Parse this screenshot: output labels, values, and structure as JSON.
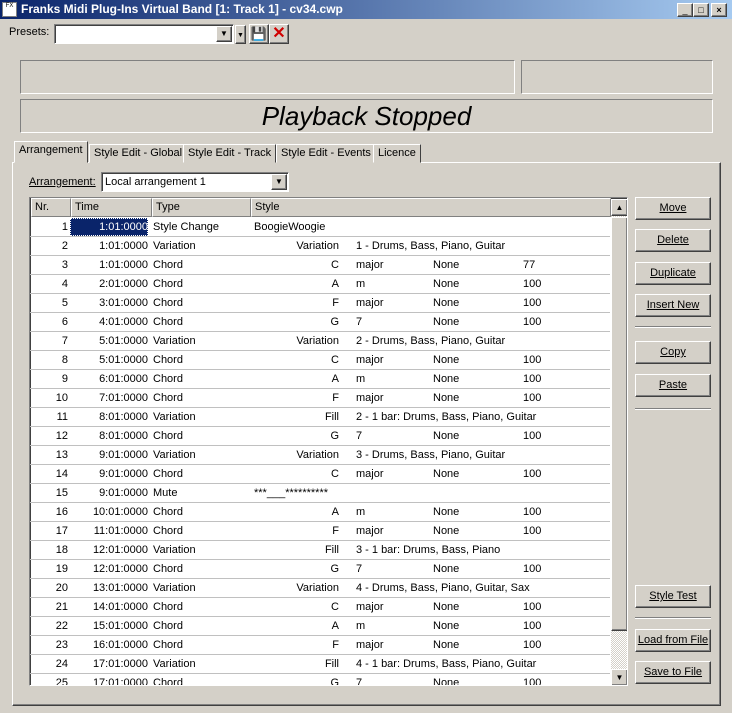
{
  "window": {
    "title": "Franks Midi Plug-Ins Virtual Band [1: Track 1] - cv34.cwp",
    "icon_text": "FX"
  },
  "presets": {
    "label": "Presets:",
    "value": ""
  },
  "status": {
    "playback": "Playback Stopped"
  },
  "tabs": [
    {
      "label": "Arrangement",
      "active": true
    },
    {
      "label": "Style Edit - Global"
    },
    {
      "label": "Style Edit - Track"
    },
    {
      "label": "Style Edit - Events"
    },
    {
      "label": "Licence"
    }
  ],
  "arrangement": {
    "label": "Arrangement:",
    "value": "Local arrangement 1"
  },
  "table": {
    "columns": [
      "Nr.",
      "Time",
      "Type",
      "Style"
    ],
    "rows": [
      {
        "nr": "1",
        "time": "1:01:0000",
        "type": "Style Change",
        "style": "BoogieWoogie"
      },
      {
        "nr": "2",
        "time": "1:01:0000",
        "type": "Variation",
        "main": "Variation",
        "sub": "1 - Drums, Bass, Piano, Guitar"
      },
      {
        "nr": "3",
        "time": "1:01:0000",
        "type": "Chord",
        "main": "C",
        "sub": "major",
        "none": "None",
        "val": "77"
      },
      {
        "nr": "4",
        "time": "2:01:0000",
        "type": "Chord",
        "main": "A",
        "sub": "m",
        "none": "None",
        "val": "100"
      },
      {
        "nr": "5",
        "time": "3:01:0000",
        "type": "Chord",
        "main": "F",
        "sub": "major",
        "none": "None",
        "val": "100"
      },
      {
        "nr": "6",
        "time": "4:01:0000",
        "type": "Chord",
        "main": "G",
        "sub": "7",
        "none": "None",
        "val": "100"
      },
      {
        "nr": "7",
        "time": "5:01:0000",
        "type": "Variation",
        "main": "Variation",
        "sub": "2 - Drums, Bass, Piano, Guitar"
      },
      {
        "nr": "8",
        "time": "5:01:0000",
        "type": "Chord",
        "main": "C",
        "sub": "major",
        "none": "None",
        "val": "100"
      },
      {
        "nr": "9",
        "time": "6:01:0000",
        "type": "Chord",
        "main": "A",
        "sub": "m",
        "none": "None",
        "val": "100"
      },
      {
        "nr": "10",
        "time": "7:01:0000",
        "type": "Chord",
        "main": "F",
        "sub": "major",
        "none": "None",
        "val": "100"
      },
      {
        "nr": "11",
        "time": "8:01:0000",
        "type": "Variation",
        "main": "Fill",
        "sub": "2 - 1 bar: Drums, Bass, Piano, Guitar"
      },
      {
        "nr": "12",
        "time": "8:01:0000",
        "type": "Chord",
        "main": "G",
        "sub": "7",
        "none": "None",
        "val": "100"
      },
      {
        "nr": "13",
        "time": "9:01:0000",
        "type": "Variation",
        "main": "Variation",
        "sub": "3 - Drums, Bass, Piano, Guitar"
      },
      {
        "nr": "14",
        "time": "9:01:0000",
        "type": "Chord",
        "main": "C",
        "sub": "major",
        "none": "None",
        "val": "100"
      },
      {
        "nr": "15",
        "time": "9:01:0000",
        "type": "Mute",
        "style": "***___**********"
      },
      {
        "nr": "16",
        "time": "10:01:0000",
        "type": "Chord",
        "main": "A",
        "sub": "m",
        "none": "None",
        "val": "100"
      },
      {
        "nr": "17",
        "time": "11:01:0000",
        "type": "Chord",
        "main": "F",
        "sub": "major",
        "none": "None",
        "val": "100"
      },
      {
        "nr": "18",
        "time": "12:01:0000",
        "type": "Variation",
        "main": "Fill",
        "sub": "3 - 1 bar: Drums, Bass, Piano"
      },
      {
        "nr": "19",
        "time": "12:01:0000",
        "type": "Chord",
        "main": "G",
        "sub": "7",
        "none": "None",
        "val": "100"
      },
      {
        "nr": "20",
        "time": "13:01:0000",
        "type": "Variation",
        "main": "Variation",
        "sub": "4 - Drums, Bass, Piano, Guitar, Sax"
      },
      {
        "nr": "21",
        "time": "14:01:0000",
        "type": "Chord",
        "main": "C",
        "sub": "major",
        "none": "None",
        "val": "100"
      },
      {
        "nr": "22",
        "time": "15:01:0000",
        "type": "Chord",
        "main": "A",
        "sub": "m",
        "none": "None",
        "val": "100"
      },
      {
        "nr": "23",
        "time": "16:01:0000",
        "type": "Chord",
        "main": "F",
        "sub": "major",
        "none": "None",
        "val": "100"
      },
      {
        "nr": "24",
        "time": "17:01:0000",
        "type": "Variation",
        "main": "Fill",
        "sub": "4 - 1 bar: Drums, Bass, Piano, Guitar"
      },
      {
        "nr": "25",
        "time": "17:01:0000",
        "type": "Chord",
        "main": "G",
        "sub": "7",
        "none": "None",
        "val": "100"
      }
    ]
  },
  "buttons": {
    "move": "Move",
    "delete": "Delete",
    "duplicate": "Duplicate",
    "insert_new": "Insert New",
    "copy": "Copy",
    "paste": "Paste",
    "style_test": "Style Test",
    "load": "Load from File",
    "save": "Save to File"
  },
  "colors": {
    "titlebar": "#0a246a",
    "selection": "#0a246a",
    "face": "#d4d0c8"
  }
}
